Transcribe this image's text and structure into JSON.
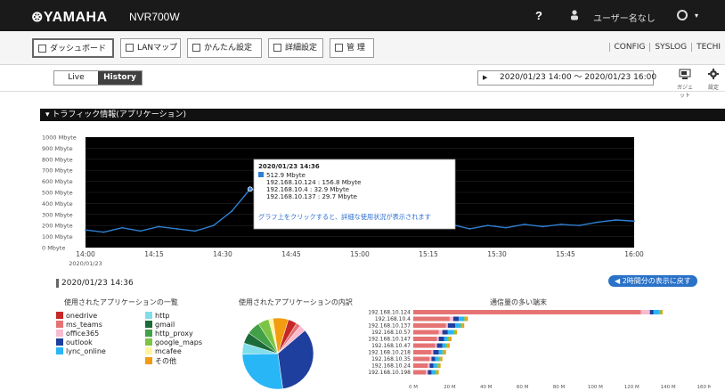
{
  "topbar": {
    "logo": "⊛YAMAHA",
    "model": "NVR700W",
    "help": "?",
    "user": "ユーザー名なし"
  },
  "toolbar": {
    "tabs": [
      "ダッシュボード",
      "LANマップ",
      "かんたん設定",
      "詳細設定",
      "管 理"
    ],
    "links": [
      "CONFIG",
      "SYSLOG",
      "TECHI"
    ]
  },
  "view": {
    "live": "Live",
    "history": "History",
    "range": "2020/01/23 14:00 ～ 2020/01/23 16:00",
    "range_arrow": "▶",
    "gadget": "ガジェット",
    "settings": "設定"
  },
  "panel": {
    "title": "▾ トラフィック情報(アプリケーション)"
  },
  "chart_data": {
    "type": "line",
    "ylabel_ticks": [
      "1000 Mbyte",
      "900 Mbyte",
      "800 Mbyte",
      "700 Mbyte",
      "600 Mbyte",
      "500 Mbyte",
      "400 Mbyte",
      "300 Mbyte",
      "200 Mbyte",
      "100 Mbyte",
      "0 Mbyte"
    ],
    "ylim": [
      0,
      1000
    ],
    "xticks": [
      "14:00",
      "14:15",
      "14:30",
      "14:45",
      "15:00",
      "15:15",
      "15:30",
      "15:45",
      "16:00"
    ],
    "xdate": "2020/01/23",
    "x_minutes": [
      0,
      4,
      8,
      12,
      16,
      20,
      24,
      28,
      32,
      36,
      40,
      44,
      48,
      52,
      56,
      60,
      64,
      68,
      72,
      76,
      80,
      84,
      88,
      92,
      96,
      100,
      104,
      108,
      112,
      116,
      120
    ],
    "y": [
      160,
      140,
      180,
      150,
      190,
      170,
      150,
      200,
      330,
      530,
      500,
      280,
      230,
      210,
      220,
      200,
      180,
      210,
      190,
      200,
      210,
      170,
      200,
      180,
      210,
      190,
      210,
      200,
      230,
      250,
      240
    ],
    "tooltip": {
      "time": "2020/01/23 14:36",
      "total": "512.9 Mbyte",
      "rows": [
        "192.168.10.124 : 156.8 Mbyte",
        "192.168.10.4 : 32.9 Mbyte",
        "192.168.10.137 : 29.7 Mbyte"
      ],
      "hint": "グラフ上をクリックすると、詳細な使用状況が表示されます"
    }
  },
  "selected": {
    "time": "2020/01/23 14:36",
    "back": "◀ 2時間分の表示に戻す"
  },
  "apps": {
    "title": "使用されたアプリケーションの一覧",
    "items": [
      {
        "name": "onedrive",
        "color": "#c62828"
      },
      {
        "name": "ms_teams",
        "color": "#e57373"
      },
      {
        "name": "office365",
        "color": "#f8bbd0"
      },
      {
        "name": "outlook",
        "color": "#1e3f9e"
      },
      {
        "name": "lync_online",
        "color": "#29b6f6"
      },
      {
        "name": "http",
        "color": "#80deea"
      },
      {
        "name": "gmail",
        "color": "#1b6b3a"
      },
      {
        "name": "http_proxy",
        "color": "#43a047"
      },
      {
        "name": "google_maps",
        "color": "#7cc544"
      },
      {
        "name": "mcafee",
        "color": "#fff59d"
      },
      {
        "name": "その他",
        "color": "#f39c12"
      }
    ]
  },
  "pie": {
    "title": "使用されたアプリケーションの内訳"
  },
  "terminals": {
    "title": "通信量の多い端末",
    "rows": [
      "192.168.10.124",
      "192.168.10.4",
      "192.168.10.137",
      "192.168.10.57",
      "192.168.10.147",
      "192.168.10.47",
      "192.168.10.218",
      "192.168.10.35",
      "192.168.10.24",
      "192.168.10.198"
    ],
    "xticks": [
      "0 M",
      "20 M",
      "40 M",
      "60 M",
      "80 M",
      "100 M",
      "120 M",
      "140 M",
      "160 M"
    ]
  }
}
